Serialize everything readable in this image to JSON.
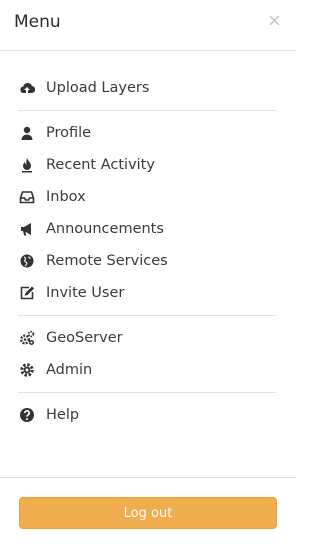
{
  "header": {
    "title": "Menu",
    "close_label": "×"
  },
  "menu": {
    "upload_layers": {
      "label": "Upload Layers",
      "icon": "cloud-upload-icon"
    },
    "profile": {
      "label": "Profile",
      "icon": "user-icon"
    },
    "recent_activity": {
      "label": "Recent Activity",
      "icon": "fire-icon"
    },
    "inbox": {
      "label": "Inbox",
      "icon": "inbox-icon"
    },
    "announcements": {
      "label": "Announcements",
      "icon": "bullhorn-icon"
    },
    "remote_services": {
      "label": "Remote Services",
      "icon": "globe-icon"
    },
    "invite_user": {
      "label": "Invite User",
      "icon": "edit-icon"
    },
    "geoserver": {
      "label": "GeoServer",
      "icon": "cogs-icon"
    },
    "admin": {
      "label": "Admin",
      "icon": "cog-icon"
    },
    "help": {
      "label": "Help",
      "icon": "question-circle-icon"
    }
  },
  "footer": {
    "logout_label": "Log out"
  },
  "colors": {
    "logout_bg": "#f0ad4e",
    "icon": "#333333",
    "divider": "#e2e2e2"
  }
}
